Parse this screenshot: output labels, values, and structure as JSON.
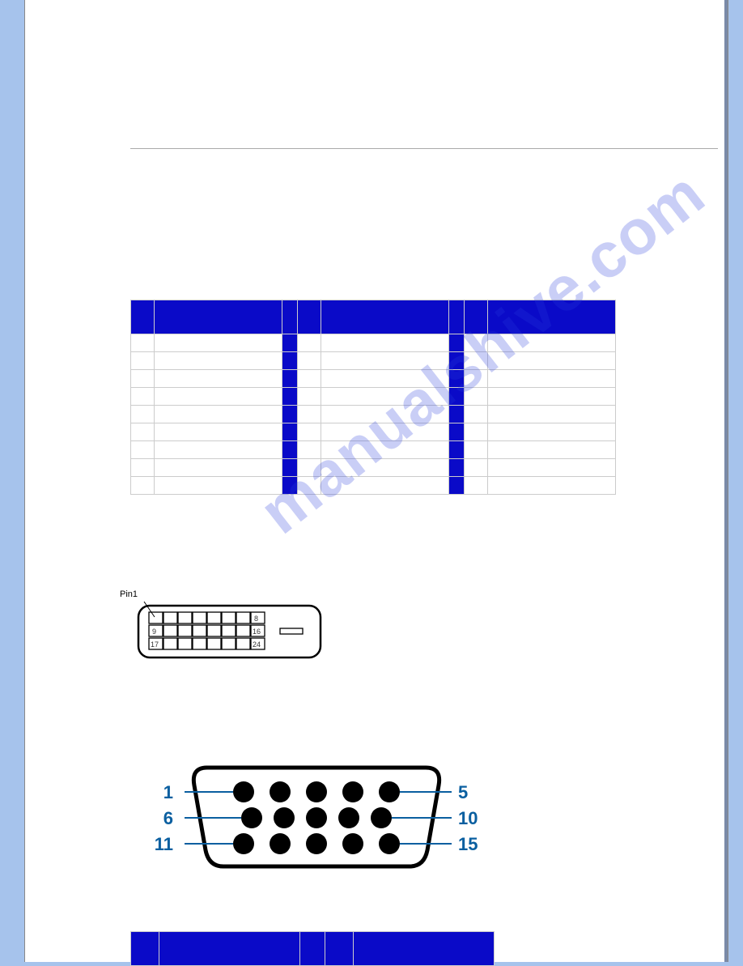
{
  "watermark": "manualshive.com",
  "dvi": {
    "pin1_label": "Pin1",
    "numbers": [
      "8",
      "9",
      "16",
      "17",
      "24"
    ]
  },
  "vga": {
    "left_numbers": [
      "1",
      "6",
      "11"
    ],
    "right_numbers": [
      "5",
      "10",
      "15"
    ]
  },
  "colors": {
    "table_header": "#0a0ac8",
    "page_bg": "#a6c3ec",
    "vga_line": "#0a5fa0",
    "vga_number": "#0a5fa0"
  }
}
